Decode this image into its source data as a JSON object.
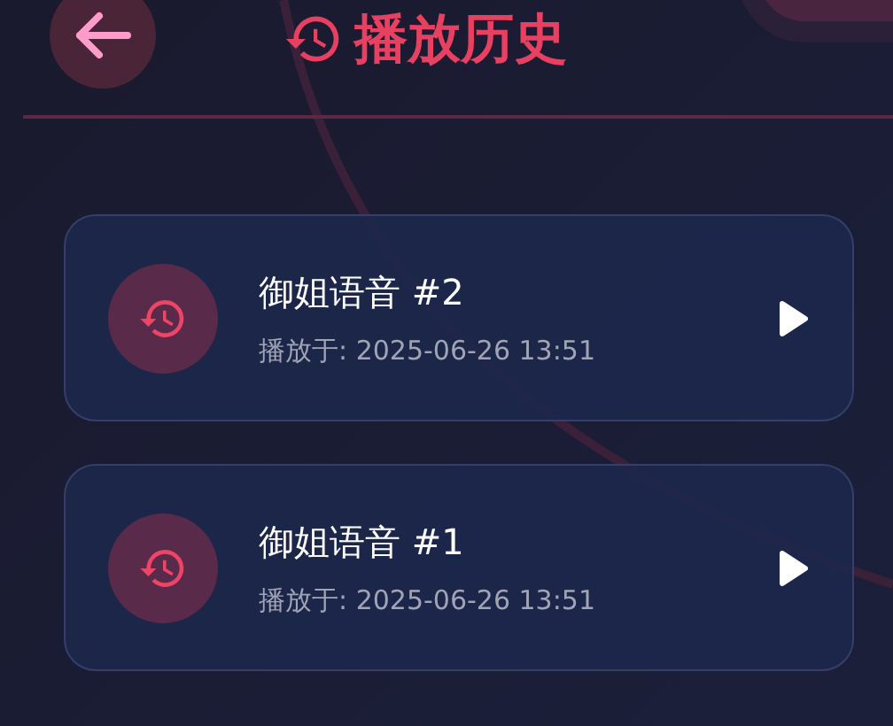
{
  "header": {
    "title": "播放历史"
  },
  "history": [
    {
      "title": "御姐语音 #2",
      "played_at": "播放于: 2025-06-26 13:51"
    },
    {
      "title": "御姐语音 #1",
      "played_at": "播放于: 2025-06-26 13:51"
    }
  ]
}
